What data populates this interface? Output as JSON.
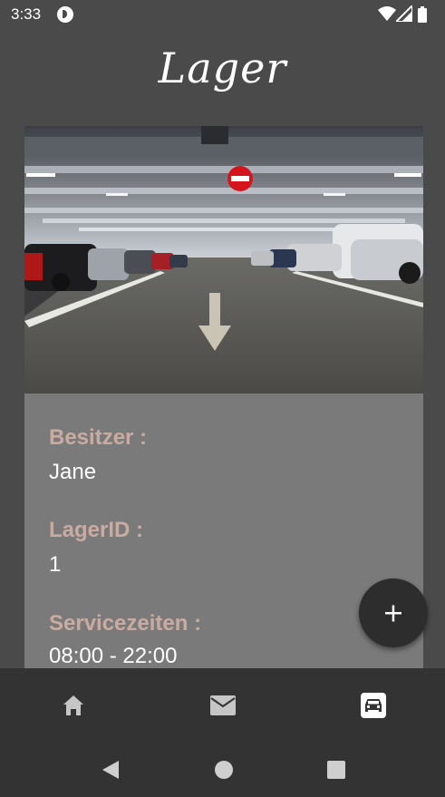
{
  "status_bar": {
    "time": "3:33"
  },
  "header": {
    "title": "Lager"
  },
  "storage": {
    "owner_label": "Besitzer :",
    "owner_value": "Jane",
    "id_label": "LagerID :",
    "id_value": "1",
    "hours_label": "Servicezeiten :",
    "hours_value": "08:00 - 22:00"
  },
  "fab": {
    "icon": "plus-icon"
  },
  "bottom_nav": {
    "items": [
      {
        "icon": "home-icon",
        "active": false
      },
      {
        "icon": "mail-icon",
        "active": false
      },
      {
        "icon": "car-icon",
        "active": true
      }
    ]
  },
  "colors": {
    "background": "#4a4a4a",
    "card": "#7a7a7a",
    "label": "#c9aba2",
    "nav_bar": "#333333",
    "fab": "#2d2d2d"
  }
}
